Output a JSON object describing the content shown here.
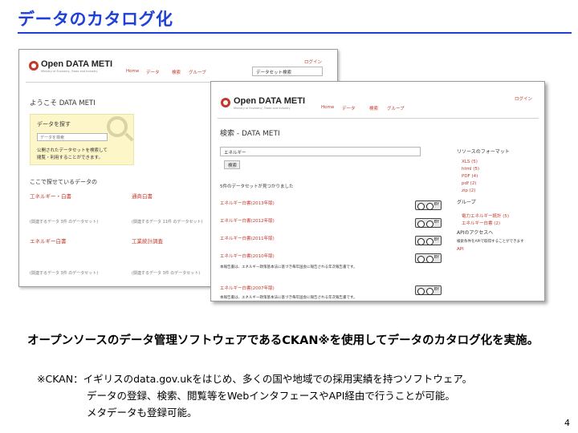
{
  "slide": {
    "title": "データのカタログ化",
    "caption": "オープンソースのデータ管理ソフトウェアであるCKAN※を使用してデータのカタログ化を実施。",
    "note_line1": "※CKAN：イギリスのdata.gov.ukをはじめ、多くの国や地域での採用実績を持つソフトウェア。",
    "note_line2": "データの登録、検索、閲覧等をWebインタフェースやAPI経由で行うことが可能。",
    "note_line3": "メタデータも登録可能。",
    "page_number": "4"
  },
  "back_screenshot": {
    "logo_text": "Open DATA METI",
    "logo_subtitle": "Ministry of Economy, Trade and Industry",
    "login_link": "ログイン",
    "nav": [
      "Home",
      "データ",
      "検索",
      "グループ"
    ],
    "search_placeholder": "データセット検索",
    "welcome_heading": "ようこそ DATA METI",
    "promo_heading": "データを探す",
    "promo_placeholder": "データを検索",
    "promo_text_1": "公開されたデータセットを検索して",
    "promo_text_2": "閲覧・利用することができます。",
    "section_heading": "ここで探せているデータの",
    "groups": [
      {
        "name": "工ネルギー・白書",
        "count": "(関連するデータ 3件 のデータセット)"
      },
      {
        "name": "通商白書",
        "count": "(関連するデータ 11件 のデータセット)"
      },
      {
        "name": "エネルギー白書",
        "count": "(関連するデータ 3件 のデータセット)"
      },
      {
        "name": "工業統計調査",
        "count": "(関連するデータ 3件 のデータセット)"
      }
    ]
  },
  "front_screenshot": {
    "logo_text": "Open DATA METI",
    "logo_subtitle": "Ministry of Economy, Trade and Industry",
    "login_link": "ログイン",
    "nav": [
      "Home",
      "データ",
      "検索",
      "グループ"
    ],
    "page_heading": "検索 - DATA METI",
    "search_value": "エネルギー",
    "search_button": "検索",
    "result_summary": "5件のデータセットが見つかりました",
    "facet_heading": "リソースのフォーマット",
    "formats": [
      "XLS (5)",
      "html (5)",
      "PDF (4)",
      "pdf (2)",
      "zip (2)"
    ],
    "group_heading": "グループ",
    "groups": [
      "電力エネルギー統計 (5)",
      "エネルギー白書 (2)"
    ],
    "api_heading": "APIのアクセスへ",
    "api_text": "検索条件をAPIで取得することができます",
    "api_link": "API",
    "results": [
      {
        "title": "エネルギー白書(2013年版)",
        "desc": "",
        "license": "BY"
      },
      {
        "title": "エネルギー白書(2012年版)",
        "desc": "",
        "license": "BY"
      },
      {
        "title": "エネルギー白書(2011年版)",
        "desc": "",
        "license": "BY"
      },
      {
        "title": "エネルギー白書(2010年版)",
        "desc": "本報告書は、エネルギー政策基本法に基づき毎年国会に報告される年次報告書です。",
        "license": "BY"
      },
      {
        "title": "エネルギー白書(2007年版)",
        "desc": "本報告書は、エネルギー政策基本法に基づき毎年国会に報告される年次報告書です。",
        "license": "BY"
      }
    ]
  },
  "colors": {
    "title_blue": "#1f3fd6",
    "link_red": "#c0392b",
    "promo_yellow": "#fdf6c8"
  }
}
